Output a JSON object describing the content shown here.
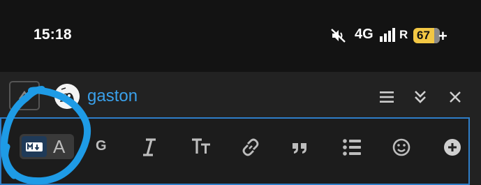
{
  "status_bar": {
    "time": "15:18",
    "network": "4G",
    "roaming": "R",
    "battery_level": "67",
    "icons": [
      "mute-icon",
      "signal-icon",
      "charging-icon"
    ]
  },
  "composer": {
    "username": "gaston",
    "header_icons": [
      "collapse-icon",
      "menu-icon",
      "double-chevron-down-icon",
      "close-icon"
    ],
    "toolbar": {
      "markdown_toggle": {
        "rich_text_label": "A"
      },
      "g_label": "G",
      "icons": [
        "markdown-icon",
        "italic-icon",
        "heading-icon",
        "link-icon",
        "quote-icon",
        "bullet-list-icon",
        "emoji-icon",
        "add-icon"
      ]
    }
  },
  "colors": {
    "background": "#131313",
    "composer_bg": "#222222",
    "accent_blue": "#3aa0ea",
    "annotation_blue": "#1e9be6",
    "battery_yellow": "#f2c744"
  }
}
